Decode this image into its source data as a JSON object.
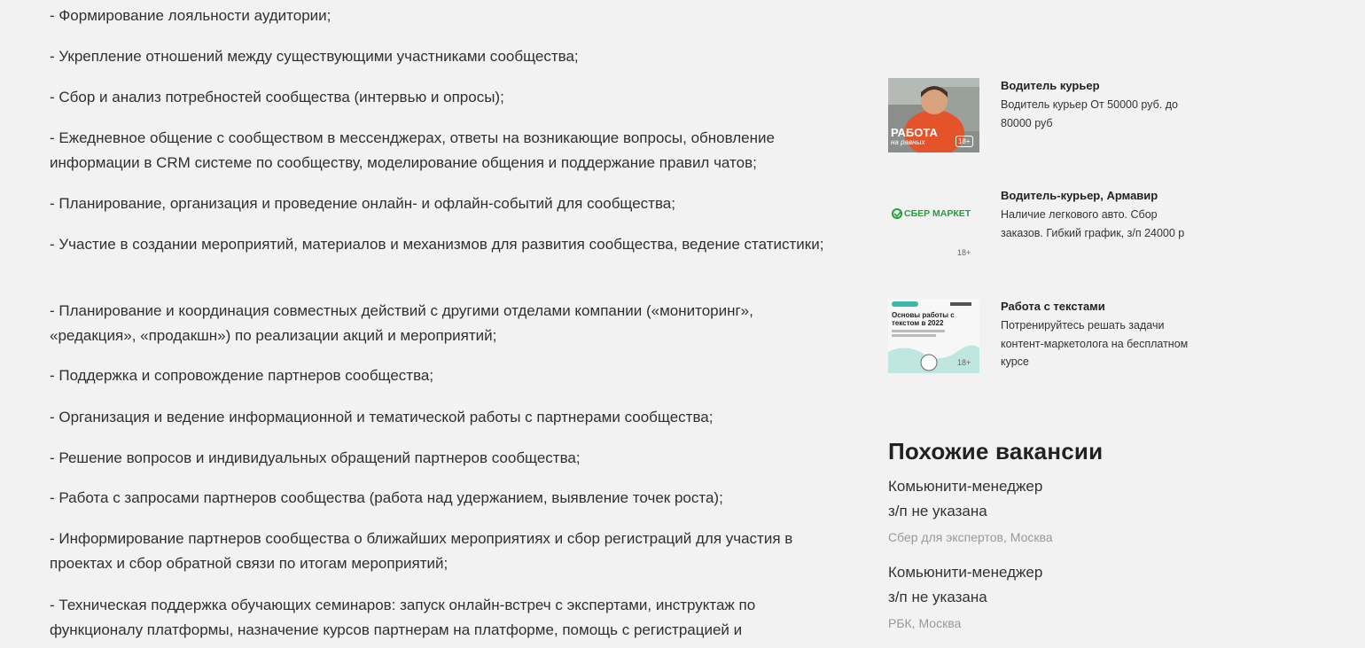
{
  "duties": [
    "- Формирование лояльности аудитории;",
    "- Укрепление отношений между существующими участниками сообщества;",
    "- Сбор и анализ потребностей сообщества (интервью и опросы);",
    "- Ежедневное общение с сообществом в мессенджерах, ответы на возникающие вопросы, обновление информации в CRM системе по сообществу, моделирование общения и поддержание правил чатов;",
    "- Планирование, организация и проведение онлайн- и офлайн-событий для сообщества;",
    "- Участие в создании мероприятий, материалов и механизмов для развития сообщества, ведение статистики;",
    "- Планирование и координация совместных действий с другими отделами компании («мониторинг», «редакция», «продакшн») по реализации акций и мероприятий;",
    "- Поддержка и сопровождение партнеров сообщества;",
    "- Организация и ведение информационной и тематической работы с партнерами сообщества;",
    "- Решение вопросов и индивидуальных обращений партнеров сообщества;",
    "- Работа с запросами партнеров сообщества (работа над удержанием, выявление точек роста);",
    "- Информирование партнеров сообщества о ближайших мероприятиях и сбор регистраций для участия в проектах и сбор обратной связи по итогам мероприятий;",
    "- Техническая поддержка обучающих семинаров: запуск онлайн-встреч с экспертами, инструктаж по функционалу платформы, назначение курсов партнерам на платформе, помощь с регистрацией и"
  ],
  "ads": [
    {
      "title": "Водитель курьер",
      "description": "Водитель курьер От 50000 руб. до 80000 руб",
      "thumb_text": "РАБОТА",
      "thumb_sub": "на равных",
      "age": "18+"
    },
    {
      "title": "Водитель-курьер, Армавир",
      "description": "Наличие легкового авто. Сбор заказов. Гибкий график, з/п 24000 р",
      "logo_text": "СБЕР МАРКЕТ",
      "age": "18+"
    },
    {
      "title": "Работа с текстами",
      "description": "Потренируйтесь решать задачи контент-маркетолога на бесплатном курсе",
      "thumb_text": "Основы работы с текстом в 2022",
      "age": "18+"
    }
  ],
  "similar": {
    "title": "Похожие вакансии",
    "items": [
      {
        "name": "Комьюнити-менеджер",
        "salary": "з/п не указана",
        "company": "Сбер для экспертов, Москва"
      },
      {
        "name": "Комьюнити-менеджер",
        "salary": "з/п не указана",
        "company": "РБК, Москва"
      }
    ]
  },
  "colors": {
    "background": "#f2f2f2",
    "text": "#303030",
    "muted": "#999999",
    "sber_green": "#21a038",
    "sber_teal": "#3fb9a6"
  }
}
